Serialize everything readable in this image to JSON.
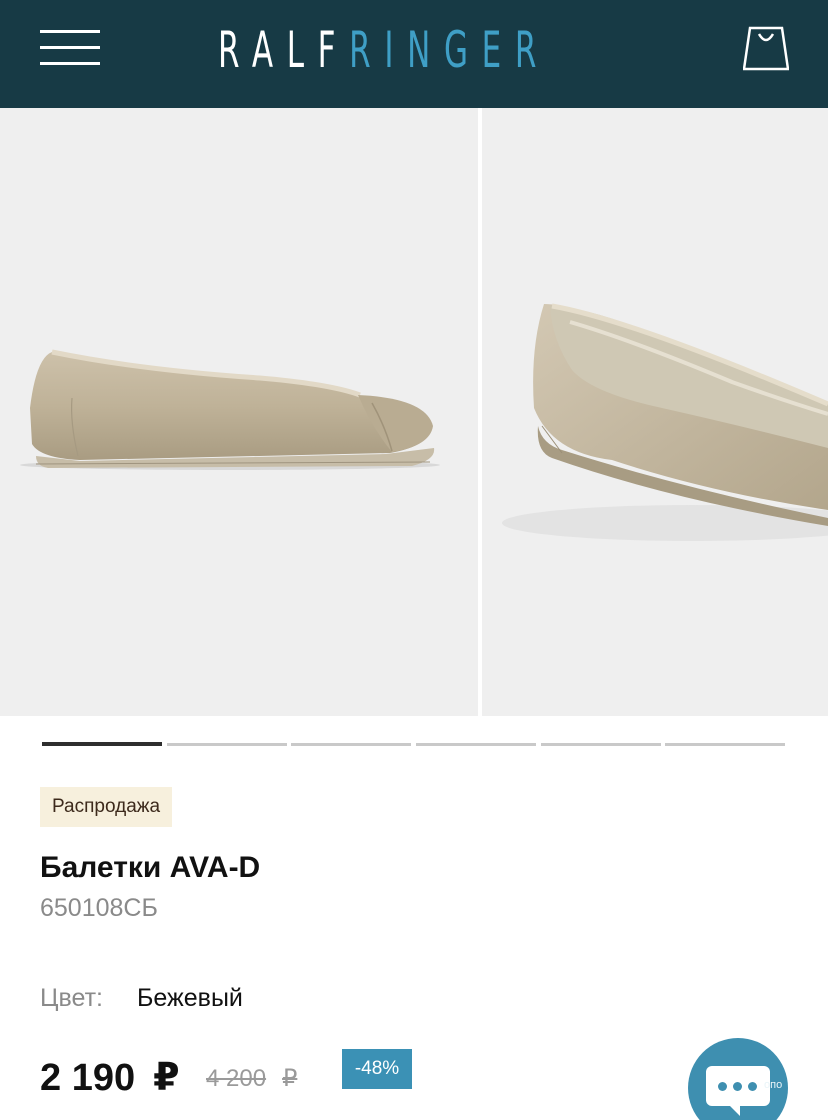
{
  "header": {
    "logo_part1": "RALF",
    "logo_part2": "RINGER",
    "menu_icon": "hamburger-icon",
    "cart_icon": "shopping-bag-icon"
  },
  "gallery": {
    "slide_count": 6,
    "active_slide": 1
  },
  "product": {
    "badge": "Распродажа",
    "title": "Балетки AVA-D",
    "sku": "650108СБ",
    "color_label": "Цвет:",
    "color_value": "Бежевый",
    "price": "2 190",
    "currency": "₽",
    "old_price": "4 200",
    "old_currency": "₽",
    "discount": "-48%"
  },
  "chat": {
    "icon": "chat-icon",
    "tag": "опо"
  },
  "colors": {
    "header_bg": "#173a45",
    "logo_accent": "#3f9fc6",
    "discount_bg": "#3b91b5",
    "badge_bg": "#f7f0dd",
    "chat_bg": "#3e8fb0"
  }
}
